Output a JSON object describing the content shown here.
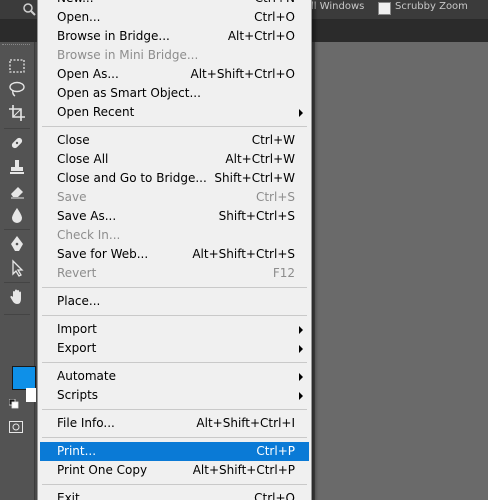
{
  "options_bar": {
    "all_windows_label": "ll Windows",
    "scrubby_zoom_label": "Scrubby Zoom"
  },
  "tools": [
    {
      "name": "rectangular-marquee-icon"
    },
    {
      "name": "lasso-icon"
    },
    {
      "name": "crop-icon"
    },
    {
      "name": "healing-brush-icon"
    },
    {
      "name": "clone-stamp-icon"
    },
    {
      "name": "eraser-icon"
    },
    {
      "name": "blur-drop-icon"
    },
    {
      "name": "pen-icon"
    },
    {
      "name": "path-selection-icon"
    },
    {
      "name": "hand-icon"
    }
  ],
  "colors": {
    "foreground": "#0e90e8",
    "background": "#ffffff",
    "menu_highlight": "#0a7ad6"
  },
  "menu": {
    "items": [
      {
        "label": "New...",
        "shortcut": "Ctrl+N",
        "state": "normal"
      },
      {
        "label": "Open...",
        "shortcut": "Ctrl+O",
        "state": "normal"
      },
      {
        "label": "Browse in Bridge...",
        "shortcut": "Alt+Ctrl+O",
        "state": "normal"
      },
      {
        "label": "Browse in Mini Bridge...",
        "shortcut": "",
        "state": "disabled"
      },
      {
        "label": "Open As...",
        "shortcut": "Alt+Shift+Ctrl+O",
        "state": "normal"
      },
      {
        "label": "Open as Smart Object...",
        "shortcut": "",
        "state": "normal"
      },
      {
        "label": "Open Recent",
        "shortcut": "",
        "state": "normal",
        "submenu": true
      },
      {
        "separator": true
      },
      {
        "label": "Close",
        "shortcut": "Ctrl+W",
        "state": "normal"
      },
      {
        "label": "Close All",
        "shortcut": "Alt+Ctrl+W",
        "state": "normal"
      },
      {
        "label": "Close and Go to Bridge...",
        "shortcut": "Shift+Ctrl+W",
        "state": "normal"
      },
      {
        "label": "Save",
        "shortcut": "Ctrl+S",
        "state": "disabled"
      },
      {
        "label": "Save As...",
        "shortcut": "Shift+Ctrl+S",
        "state": "normal"
      },
      {
        "label": "Check In...",
        "shortcut": "",
        "state": "disabled"
      },
      {
        "label": "Save for Web...",
        "shortcut": "Alt+Shift+Ctrl+S",
        "state": "normal"
      },
      {
        "label": "Revert",
        "shortcut": "F12",
        "state": "disabled"
      },
      {
        "separator": true
      },
      {
        "label": "Place...",
        "shortcut": "",
        "state": "normal"
      },
      {
        "separator": true
      },
      {
        "label": "Import",
        "shortcut": "",
        "state": "normal",
        "submenu": true
      },
      {
        "label": "Export",
        "shortcut": "",
        "state": "normal",
        "submenu": true
      },
      {
        "separator": true
      },
      {
        "label": "Automate",
        "shortcut": "",
        "state": "normal",
        "submenu": true
      },
      {
        "label": "Scripts",
        "shortcut": "",
        "state": "normal",
        "submenu": true
      },
      {
        "separator": true
      },
      {
        "label": "File Info...",
        "shortcut": "Alt+Shift+Ctrl+I",
        "state": "normal"
      },
      {
        "separator": true
      },
      {
        "label": "Print...",
        "shortcut": "Ctrl+P",
        "state": "highlight"
      },
      {
        "label": "Print One Copy",
        "shortcut": "Alt+Shift+Ctrl+P",
        "state": "normal"
      },
      {
        "separator": true
      },
      {
        "label": "Exit",
        "shortcut": "Ctrl+Q",
        "state": "normal"
      }
    ]
  }
}
